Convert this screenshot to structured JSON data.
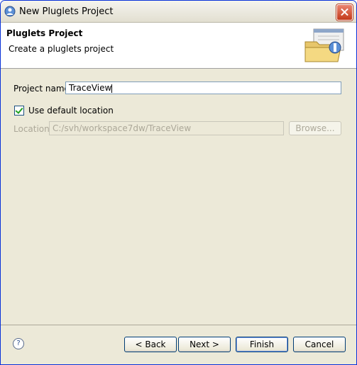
{
  "window": {
    "title": "New Pluglets Project"
  },
  "header": {
    "title": "Pluglets Project",
    "description": "Create a pluglets project"
  },
  "form": {
    "project_name_label": "Project name:",
    "project_name_value": "TraceView",
    "use_default_label": "Use default location",
    "use_default_checked": true,
    "location_label": "Location:",
    "location_value": "C:/svh/workspace7dw/TraceView",
    "browse_label": "Browse..."
  },
  "footer": {
    "help_glyph": "?",
    "back_label": "< Back",
    "next_label": "Next >",
    "finish_label": "Finish",
    "cancel_label": "Cancel"
  },
  "colors": {
    "title_bar": "#ece9d8",
    "close_button": "#c3391a",
    "dialog_bg": "#ece9d8",
    "header_bg": "#ffffff",
    "checkmark": "#21a121"
  }
}
